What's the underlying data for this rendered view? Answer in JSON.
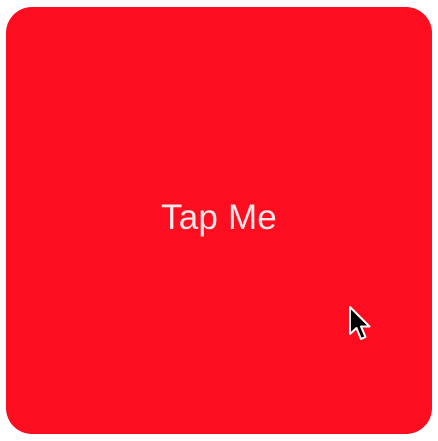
{
  "button": {
    "label": "Tap Me",
    "background_color": "#fc0d1f",
    "text_color": "#fde6e8"
  },
  "cursor": {
    "icon": "arrow-pointer"
  }
}
